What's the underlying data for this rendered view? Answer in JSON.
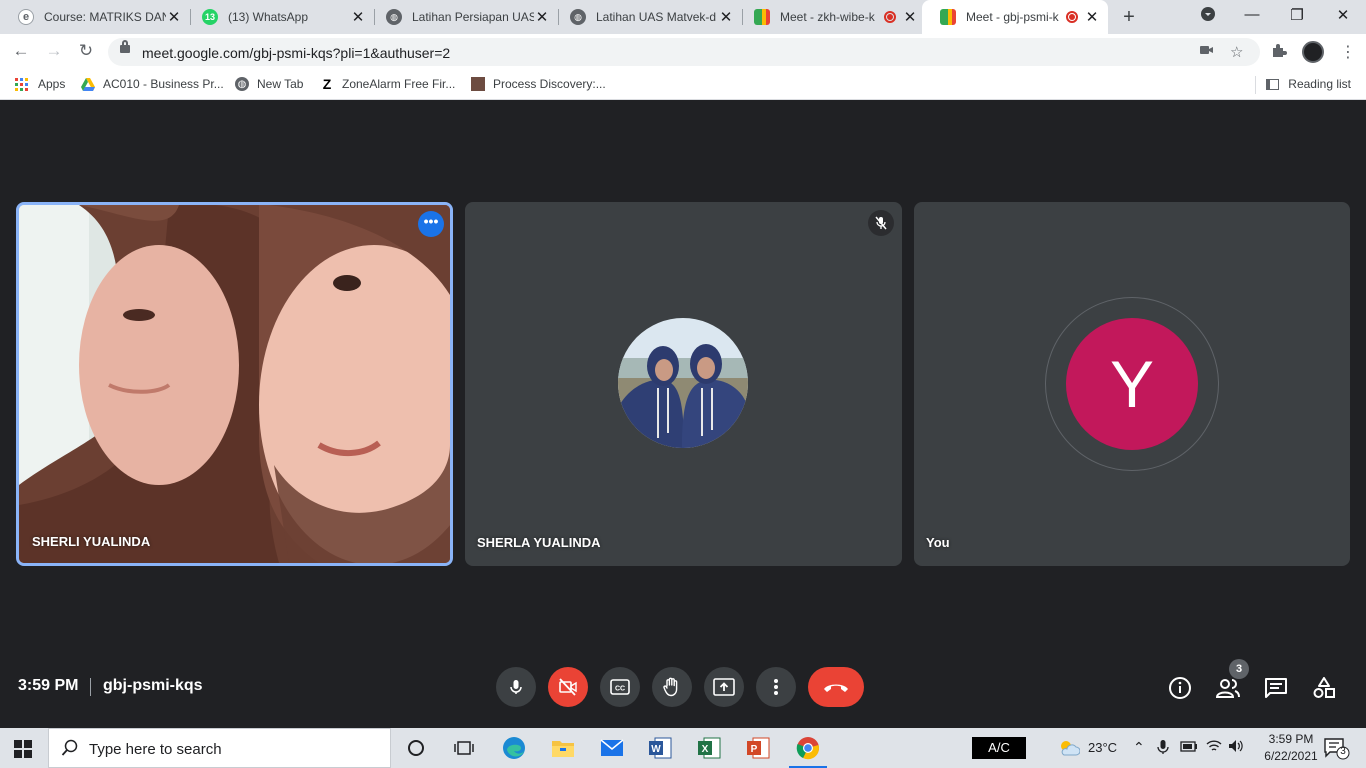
{
  "browser": {
    "tabs": [
      {
        "title": "Course: MATRIKS DAN",
        "favicon": "e-learning-icon",
        "recording": false
      },
      {
        "title": "(13) WhatsApp",
        "favicon": "whatsapp-icon",
        "badge": "13",
        "recording": false
      },
      {
        "title": "Latihan Persiapan UAS",
        "favicon": "globe-icon",
        "recording": false
      },
      {
        "title": "Latihan UAS Matvek-d",
        "favicon": "globe-icon",
        "recording": false
      },
      {
        "title": "Meet - zkh-wibe-k",
        "favicon": "meet-icon",
        "recording": true
      },
      {
        "title": "Meet - gbj-psmi-k",
        "favicon": "meet-icon",
        "recording": true,
        "active": true
      }
    ],
    "url": "meet.google.com/gbj-psmi-kqs?pli=1&authuser=2",
    "bookmarks": [
      {
        "label": "Apps",
        "icon": "apps-grid-icon"
      },
      {
        "label": "AC010 - Business Pr...",
        "icon": "google-drive-icon"
      },
      {
        "label": "New Tab",
        "icon": "globe-icon"
      },
      {
        "label": "ZoneAlarm Free Fir...",
        "icon": "zonealarm-icon"
      },
      {
        "label": "Process Discovery:...",
        "icon": "process-icon"
      }
    ],
    "reading_list": "Reading list"
  },
  "meet": {
    "participants": [
      {
        "name": "SHERLI YUALINDA",
        "video": true,
        "speaking": true
      },
      {
        "name": "SHERLA YUALINDA",
        "video": false,
        "muted": true
      },
      {
        "name": "You",
        "video": false,
        "initial": "Y",
        "avatar_color": "#c2185b"
      }
    ],
    "time": "3:59 PM",
    "separator": "|",
    "meeting_code": "gbj-psmi-kqs",
    "people_count": "3",
    "colors": {
      "background": "#202124",
      "tile": "#3c4043",
      "hangup": "#ea4335",
      "active_border": "#8ab4f8"
    }
  },
  "taskbar": {
    "search_placeholder": "Type here to search",
    "ac_label": "A/C",
    "temperature": "23°C",
    "time": "3:59 PM",
    "date": "6/22/2021",
    "notifications": "3"
  }
}
